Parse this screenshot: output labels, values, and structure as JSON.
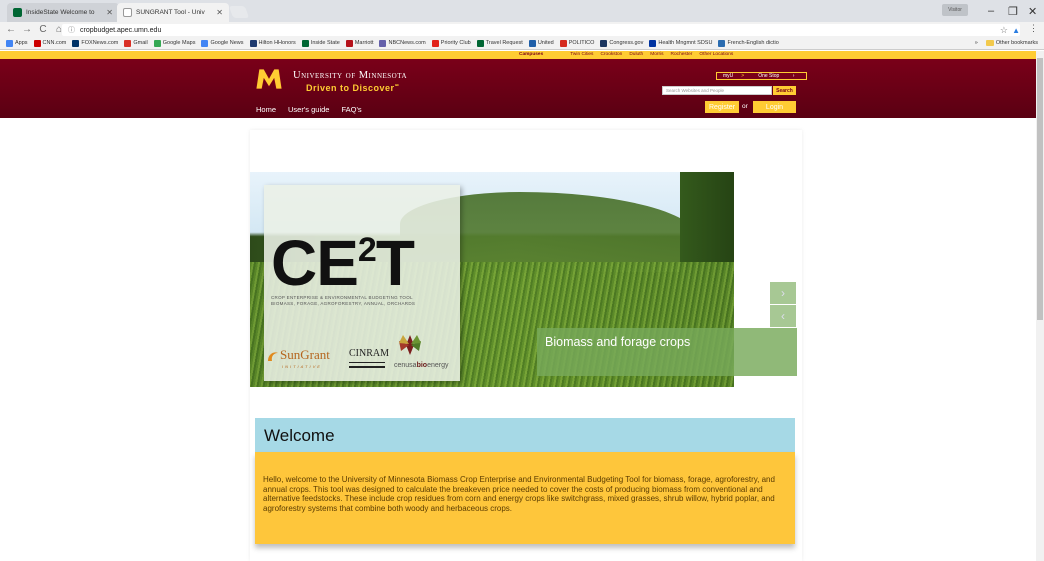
{
  "browser": {
    "tabs": [
      {
        "title": "InsideState Welcome to",
        "active": false
      },
      {
        "title": "SUNGRANT Tool - Univ",
        "active": true
      }
    ],
    "url": "cropbudget.apec.umn.edu",
    "user_chip": "Visitor",
    "bookmarks": [
      {
        "label": "Apps",
        "icon": "apps-grid-icon",
        "color": "#4285f4"
      },
      {
        "label": "CNN.com",
        "icon": "cnn-icon",
        "color": "#cc0000"
      },
      {
        "label": "FOXNews.com",
        "icon": "fox-icon",
        "color": "#003366"
      },
      {
        "label": "Gmail",
        "icon": "gmail-icon",
        "color": "#d93025"
      },
      {
        "label": "Google Maps",
        "icon": "maps-icon",
        "color": "#34a853"
      },
      {
        "label": "Google News",
        "icon": "news-icon",
        "color": "#4285f4"
      },
      {
        "label": "Hilton HHonors",
        "icon": "hilton-icon",
        "color": "#1e3a6e"
      },
      {
        "label": "Inside State",
        "icon": "inside-state-icon",
        "color": "#006633"
      },
      {
        "label": "Marriott",
        "icon": "marriott-icon",
        "color": "#b5121b"
      },
      {
        "label": "NBCNews.com",
        "icon": "nbc-icon",
        "color": "#6460aa"
      },
      {
        "label": "Priority Club",
        "icon": "priority-club-icon",
        "color": "#e2231a"
      },
      {
        "label": "Travel Request",
        "icon": "travel-icon",
        "color": "#006633"
      },
      {
        "label": "United",
        "icon": "united-icon",
        "color": "#1f5fa8"
      },
      {
        "label": "POLITICO",
        "icon": "politico-icon",
        "color": "#d52b1e"
      },
      {
        "label": "Congress.gov",
        "icon": "congress-icon",
        "color": "#1b3660"
      },
      {
        "label": "Health Mngmnt SDSU",
        "icon": "sdsu-icon",
        "color": "#0033a0"
      },
      {
        "label": "French-English dictio",
        "icon": "dictionary-icon",
        "color": "#2b6cb0"
      }
    ],
    "bookmarks_overflow": "»",
    "other_bookmarks": "Other bookmarks"
  },
  "umn": {
    "campus_links": [
      "Campuses",
      "Twin Cities",
      "Crookston",
      "Duluth",
      "Morris",
      "Rochester",
      "Other Locations"
    ],
    "university_name": "University of Minnesota",
    "tagline": "Driven to Discover",
    "tagline_mark": "℠",
    "nav": [
      "Home",
      "User's guide",
      "FAQ's"
    ],
    "myu": "myU",
    "one_stop": "One Stop",
    "search_placeholder": "Search Websites and People",
    "search_label": "Search",
    "register_label": "Register",
    "or_label": "or",
    "login_label": "Login",
    "colors": {
      "maroon": "#7a0019",
      "gold": "#ffcc33"
    }
  },
  "hero": {
    "ce_title": "CE",
    "ce_sup": "2",
    "ce_title_end": "T",
    "ce_subtitle_1": "CROP ENTERPRISE & ENVIRONMENTAL BUDGETING TOOL",
    "ce_subtitle_2": "BIOMASS, FORAGE, AGROFORESTRY, ANNUAL, ORCHARDS",
    "sungrant": "SunGrant",
    "sungrant_sub": "INITIATIVE",
    "cinram": "CINRAM",
    "cenusa_1": "cenusa",
    "cenusa_2": "bio",
    "cenusa_3": "energy",
    "caption": "Biomass and forage crops"
  },
  "welcome": {
    "heading": "Welcome",
    "body": "Hello, welcome to the University of Minnesota Biomass Crop Enterprise and Environmental Budgeting Tool for biomass, forage, agroforestry, and annual crops. This tool was designed to calculate the breakeven price needed to cover the costs of producing biomass from conventional and alternative feedstocks. These include crop residues from corn and energy crops like switchgrass, mixed grasses, shrub willow, hybrid poplar, and agroforestry systems that combine both woody and herbaceous crops."
  }
}
